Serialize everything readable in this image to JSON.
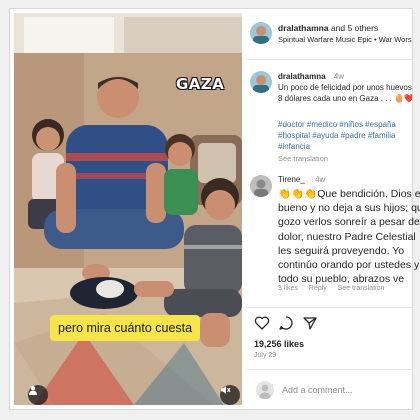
{
  "post": {
    "media": {
      "overlay_text": "GAZA",
      "caption": "pero mira cuánto cuesta"
    },
    "header": {
      "username": "dralathamna",
      "others": "and 5 others",
      "audio": "Spiritual Warfare Music Epic • War Wors..."
    },
    "caption": {
      "username": "dralathamna",
      "time": "4w",
      "lines": [
        "Un poco de felicidad por unos huevos",
        "8 dólares cada uno en Gaza . . . 🥚❤️"
      ],
      "hashtags": "#doctor #medico #niños #españa #hospital #ayuda #padre #familia #infancia",
      "see_translation": "See translation"
    },
    "comment": {
      "username": "Tirene_",
      "time": "4w",
      "lines": [
        "👏👏👏Que bendición, Dios es",
        "bueno y no deja a sus hijos; que",
        "gozo verlos sonreír a pesar del",
        "dolor, nuestro Padre Celestial",
        "les seguirá proveyendo. Yo",
        "continúo orando por ustedes y",
        "todo su pueblo, abrazos ve"
      ],
      "likes": "3 likes",
      "reply": "Reply",
      "see_translation": "See translation"
    },
    "likes": "19,256 likes",
    "date": "July 29",
    "add_comment_placeholder": "Add a comment..."
  },
  "icons": {
    "like": "heart-icon",
    "comment": "comment-icon",
    "share": "share-icon",
    "user": "user-icon",
    "mute": "mute-icon"
  },
  "colors": {
    "hashtag": "#3a6fb0",
    "caption_pill": "#f5e44a",
    "muted_text": "#8e8e8e"
  }
}
